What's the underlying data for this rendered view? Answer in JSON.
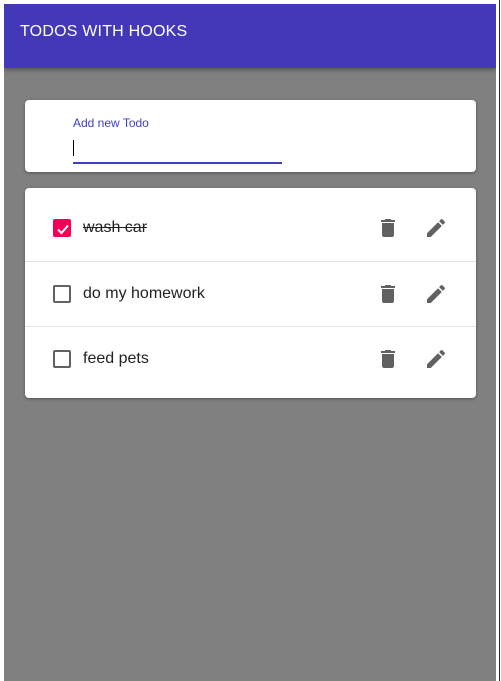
{
  "appbar": {
    "title": "TODOS WITH HOOKS"
  },
  "form": {
    "label": "Add new Todo",
    "value": ""
  },
  "todos": [
    {
      "text": "wash car",
      "completed": true
    },
    {
      "text": "do my homework",
      "completed": false
    },
    {
      "text": "feed pets",
      "completed": false
    }
  ],
  "colors": {
    "appbar": "#4338b8",
    "accent": "#f50057",
    "background": "#808080"
  },
  "icons": {
    "delete": "trash-icon",
    "edit": "pencil-icon",
    "check": "check-icon"
  }
}
